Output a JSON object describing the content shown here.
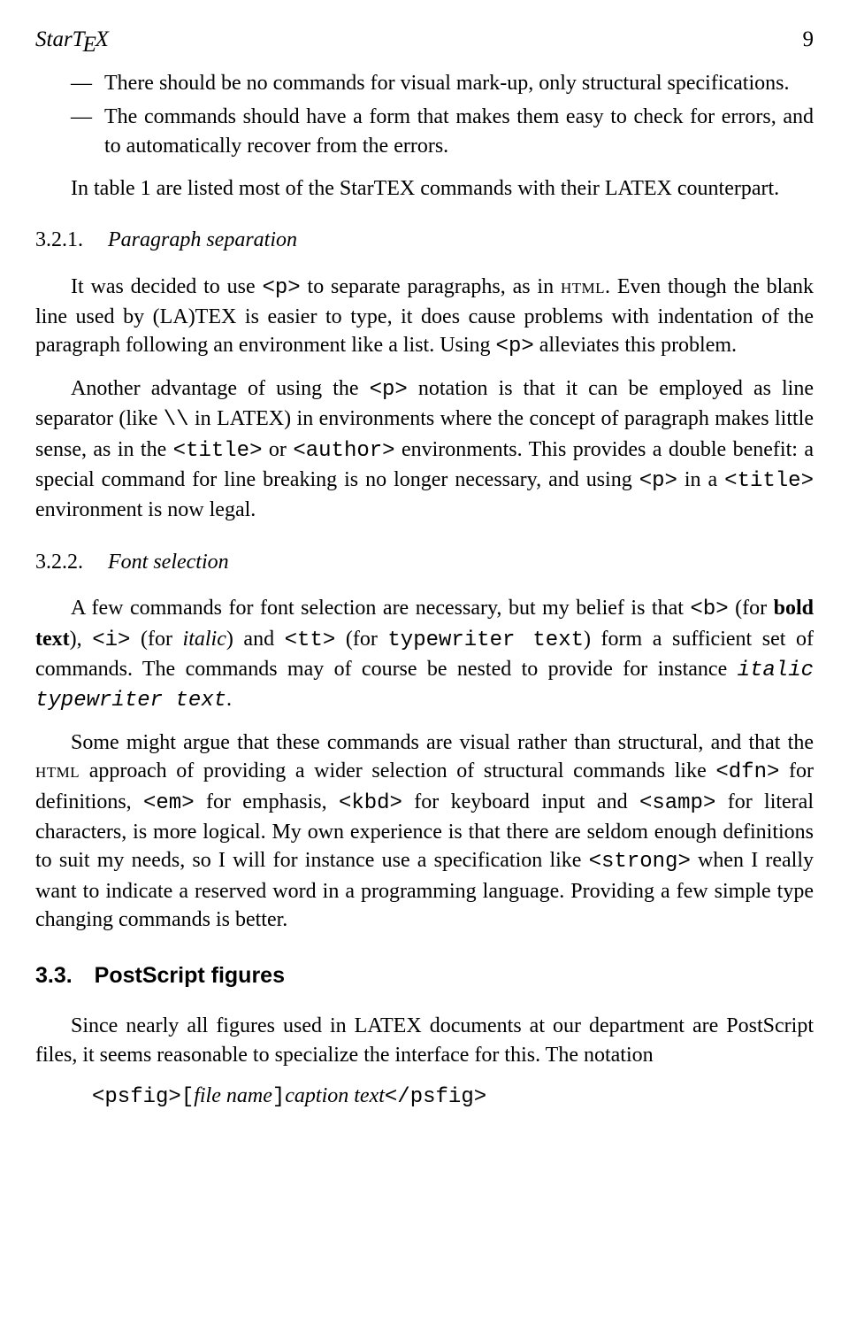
{
  "header": {
    "running_title_html": "StarT<span class='e'>E</span>X",
    "page_number": "9"
  },
  "bullets": [
    "There should be no commands for visual mark-up, only structural specifications.",
    "The commands should have a form that makes them easy to check for errors, and to automatically recover from the errors."
  ],
  "intro_html": "In table 1 are listed most of the StarT<span class='e'>E</span>X commands with their L<span class='a'>A</span>T<span class='e'>E</span>X counterpart.",
  "sec_321": {
    "number": "3.2.1.",
    "title": "Paragraph separation",
    "p1_html": "It was decided to use <span class='tt'>&lt;p&gt;</span> to separate paragraphs, as in <span class='sc'>html</span>. Even though the blank line used by (L<span class='a'>A</span>)T<span class='e'>E</span>X is easier to type, it does cause problems with indentation of the paragraph following an environment like a list. Using <span class='tt'>&lt;p&gt;</span> alleviates this problem.",
    "p2_html": "Another advantage of using the <span class='tt'>&lt;p&gt;</span> notation is that it can be employed as line separator (like <span class='tt'>\\\\</span> in L<span class='a'>A</span>T<span class='e'>E</span>X) in environments where the concept of paragraph makes little sense, as in the <span class='tt'>&lt;title&gt;</span> or <span class='tt'>&lt;author&gt;</span> environments. This provides a double benefit: a special command for line breaking is no longer necessary, and using <span class='tt'>&lt;p&gt;</span> in a <span class='tt'>&lt;title&gt;</span> environment is now legal."
  },
  "sec_322": {
    "number": "3.2.2.",
    "title": "Font selection",
    "p1_html": "A few commands for font selection are necessary, but my belief is that <span class='tt'>&lt;b&gt;</span> (for <b class='bold'>bold text</b>), <span class='tt'>&lt;i&gt;</span> (for <i class='ital'>italic</i>) and <span class='tt'>&lt;tt&gt;</span> (for <span class='tt'>typewriter text</span>) form a sufficient set of commands. The commands may of course be nested to provide for instance <span class='tti'>italic typewriter text</span>.",
    "p2_html": "Some might argue that these commands are visual rather than structural, and that the <span class='sc'>html</span> approach of providing a wider selection of structural commands like <span class='tt'>&lt;dfn&gt;</span> for definitions, <span class='tt'>&lt;em&gt;</span> for emphasis, <span class='tt'>&lt;kbd&gt;</span> for keyboard input and <span class='tt'>&lt;samp&gt;</span> for literal characters, is more logical. My own experience is that there are seldom enough definitions to suit my needs, so I will for instance use a specification like <span class='tt'>&lt;strong&gt;</span> when I really want to indicate a reserved word in a programming language. Providing a few simple type changing commands is better."
  },
  "sec_33": {
    "number": "3.3.",
    "title": "PostScript figures",
    "p1_html": "Since nearly all figures used in L<span class='a'>A</span>T<span class='e'>E</span>X documents at our department are PostScript files, it seems reasonable to specialize the interface for this. The notation",
    "code_html": "&lt;psfig&gt;[<span class='ital'>file name</span>]<span class='ital'>caption text</span>&lt;/psfig&gt;"
  }
}
